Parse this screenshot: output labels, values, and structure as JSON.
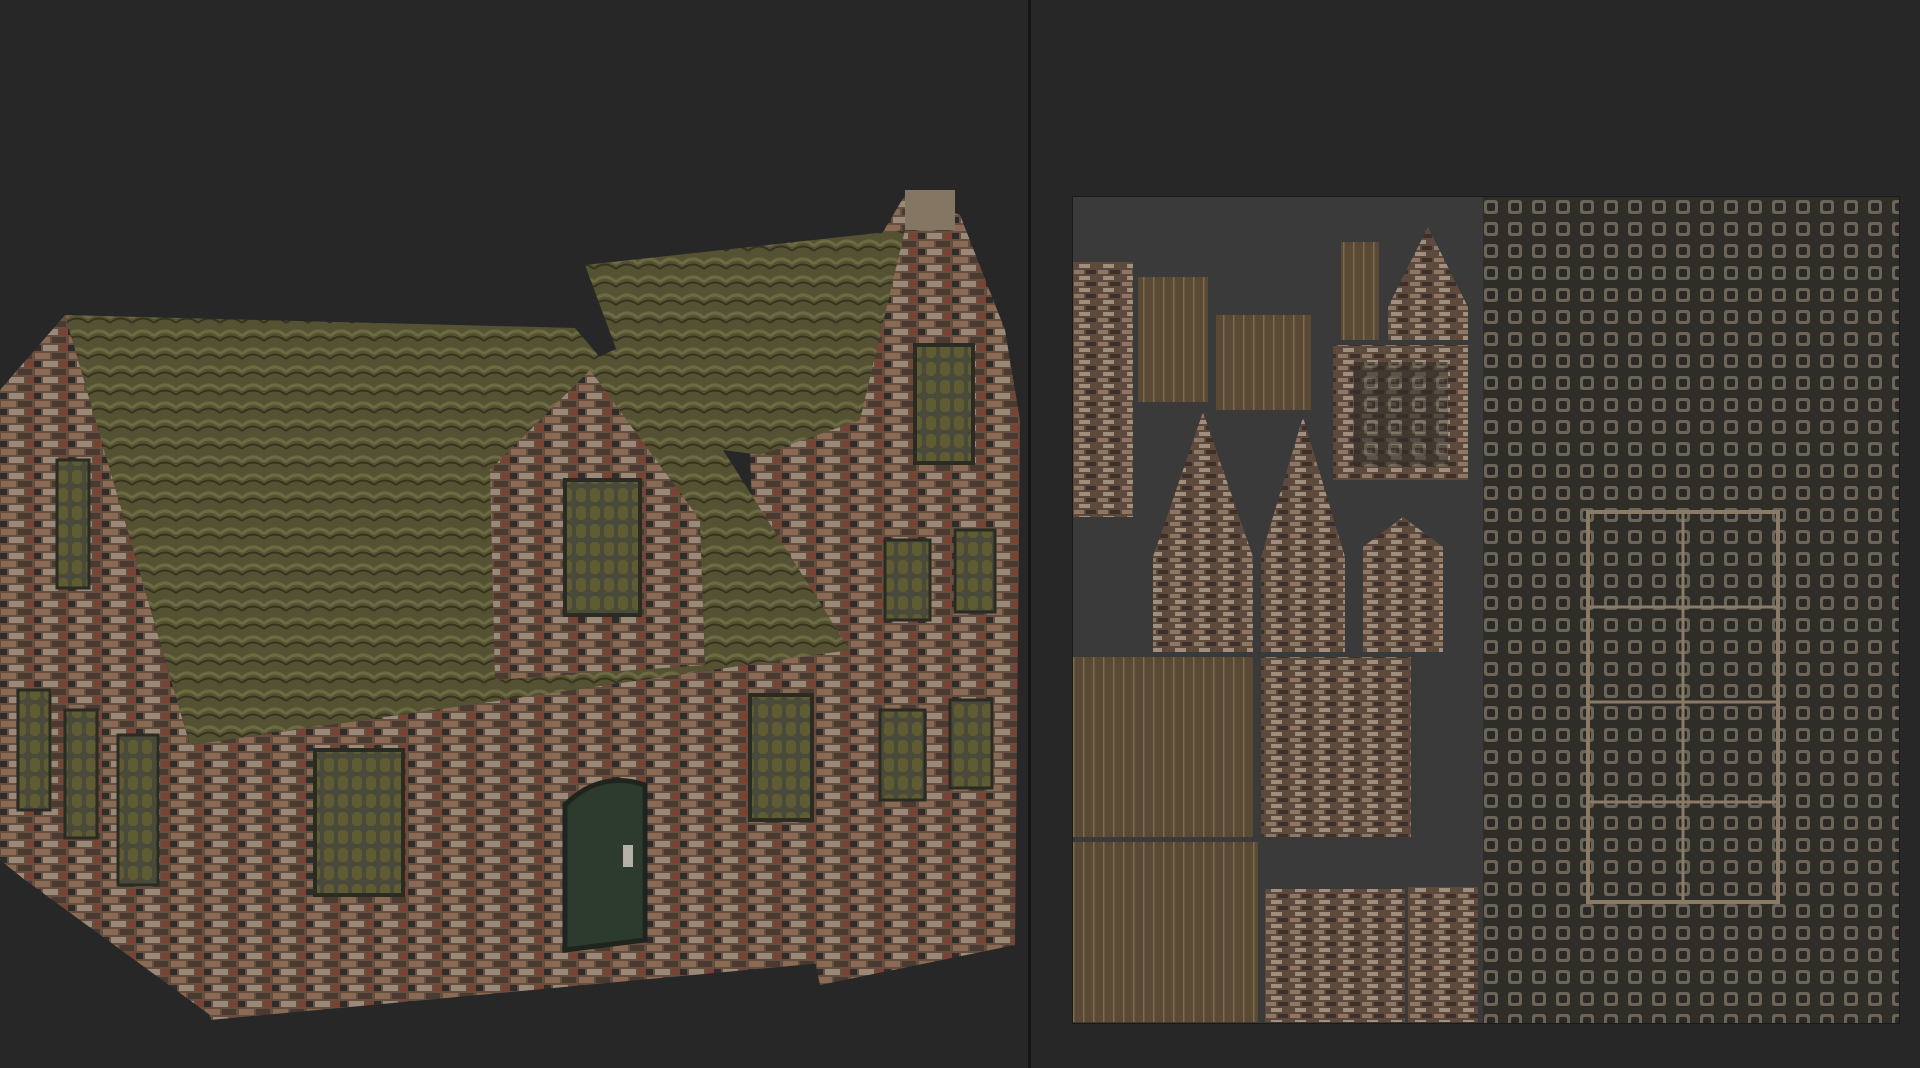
{
  "viewports": {
    "left": {
      "name": "3d-preview"
    },
    "right": {
      "name": "uv-texture-preview"
    }
  },
  "colors": {
    "background": "#272727",
    "divider": "#151515",
    "roof": "#5b5a35",
    "roof_dark": "#3f3c25",
    "brick": "#6b5446",
    "brick_dark": "#4a3a31",
    "window": "#3c3d31",
    "door": "#2d3b2e",
    "uv_bg": "#3a3a3a"
  }
}
